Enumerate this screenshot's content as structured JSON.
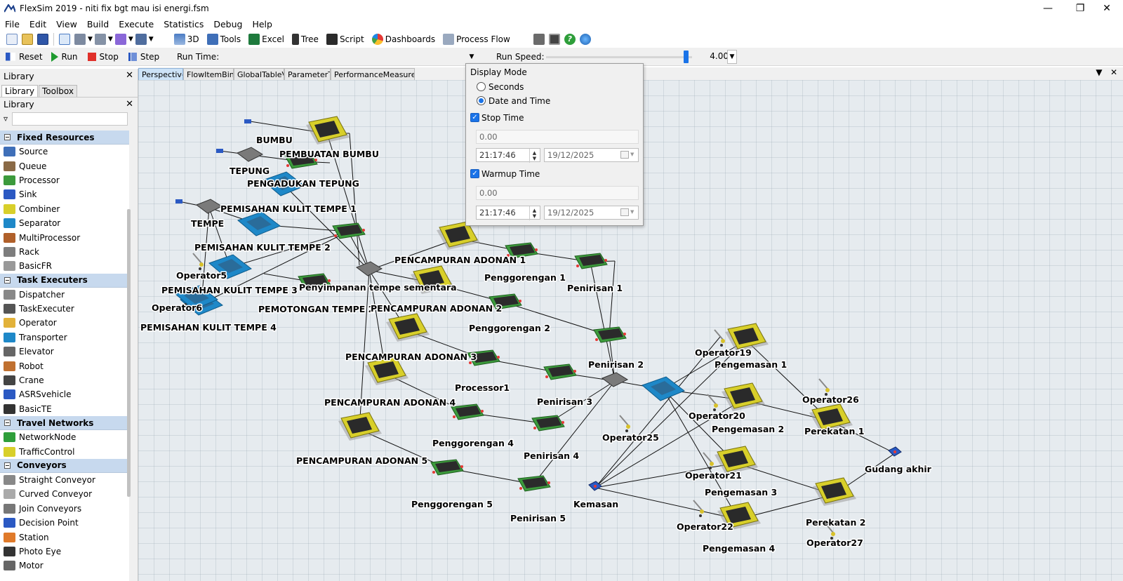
{
  "window": {
    "title": "FlexSim 2019 - niti fix bgt mau isi energi.fsm",
    "controls": [
      "minimize-icon",
      "restore-icon",
      "close-icon"
    ]
  },
  "menu": [
    "File",
    "Edit",
    "View",
    "Build",
    "Execute",
    "Statistics",
    "Debug",
    "Help"
  ],
  "toolbar": {
    "items": [
      "3D",
      "Tools",
      "Excel",
      "Tree",
      "Script",
      "Dashboards",
      "Process Flow"
    ]
  },
  "runbar": {
    "reset": "Reset",
    "run": "Run",
    "stop": "Stop",
    "step": "Step",
    "run_time_label": "Run Time:",
    "run_speed_label": "Run Speed:",
    "run_speed_value": "4.00",
    "run_speed_fraction": 0.96
  },
  "library": {
    "panel_title": "Library",
    "tabs": [
      "Library",
      "Toolbox"
    ],
    "inner_title": "Library",
    "categories": [
      {
        "name": "Fixed Resources",
        "items": [
          "Source",
          "Queue",
          "Processor",
          "Sink",
          "Combiner",
          "Separator",
          "MultiProcessor",
          "Rack",
          "BasicFR"
        ]
      },
      {
        "name": "Task Executers",
        "items": [
          "Dispatcher",
          "TaskExecuter",
          "Operator",
          "Transporter",
          "Elevator",
          "Robot",
          "Crane",
          "ASRSvehicle",
          "BasicTE"
        ]
      },
      {
        "name": "Travel Networks",
        "items": [
          "NetworkNode",
          "TrafficControl"
        ]
      },
      {
        "name": "Conveyors",
        "items": [
          "Straight Conveyor",
          "Curved Conveyor",
          "Join Conveyors",
          "Decision Point",
          "Station",
          "Photo Eye",
          "Motor"
        ]
      }
    ]
  },
  "doc_tabs": [
    "Perspective",
    "FlowItemBin",
    "GlobalTableVi",
    "ParameterTa",
    "PerformanceMeasureTa"
  ],
  "popup": {
    "display_mode_label": "Display Mode",
    "seconds_label": "Seconds",
    "date_time_label": "Date and Time",
    "stop_time_label": "Stop Time",
    "stop_time_value": "0.00",
    "stop_time_clock": "21:17:46",
    "stop_time_date": "19/12/2025",
    "warmup_label": "Warmup Time",
    "warmup_value": "0.00",
    "warmup_clock": "21:17:46",
    "warmup_date": "19/12/2025"
  },
  "scene": {
    "labels": [
      "BUMBU",
      "PEMBUATAN BUMBU",
      "TEPUNG",
      "PENGADUKAN TEPUNG",
      "TEMPE",
      "PEMISAHAN KULIT TEMPE 1",
      "PEMISAHAN KULIT TEMPE 2",
      "Operator5",
      "PEMISAHAN KULIT TEMPE 3",
      "Operator6",
      "PEMISAHAN KULIT TEMPE 4",
      "Penyimpanan tempe sementara",
      "PEMOTONGAN TEMPE 2",
      "PENCAMPURAN ADONAN 1",
      "Penggorengan 1",
      "Penirisan 1",
      "PENCAMPURAN ADONAN 2",
      "Penggorengan 2",
      "PENCAMPURAN ADONAN 3",
      "Processor1",
      "Penirisan 2",
      "PENCAMPURAN ADONAN 4",
      "Penirisan 3",
      "Penggorengan 4",
      "Penirisan 4",
      "PENCAMPURAN ADONAN 5",
      "Penggorengan 5",
      "Penirisan 5",
      "Operator25",
      "Kemasan",
      "Operator19",
      "Pengemasan 1",
      "Operator20",
      "Pengemasan 2",
      "Operator21",
      "Pengemasan 3",
      "Operator22",
      "Pengemasan 4",
      "Operator26",
      "Perekatan 1",
      "Perekatan 2",
      "Operator27",
      "Gudang akhir"
    ]
  },
  "colors": {
    "accent": "#1a73e8",
    "category_bg": "#c7d9ee",
    "viewport_bg": "#e6ebef",
    "combiner_yellow": "#d8cf2a",
    "processor_green": "#3c9a3c",
    "separator_blue": "#1e88c8",
    "queue_gray": "#7a7a7a"
  }
}
